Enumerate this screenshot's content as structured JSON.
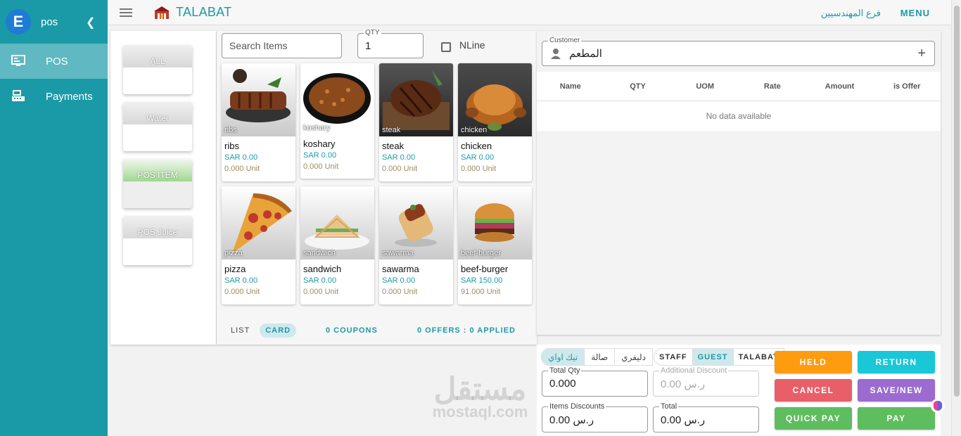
{
  "sidebar": {
    "logo_letter": "E",
    "title": "pos",
    "items": [
      {
        "label": "POS",
        "icon": "monitor-icon",
        "active": true
      },
      {
        "label": "Payments",
        "icon": "register-icon",
        "active": false
      }
    ]
  },
  "topbar": {
    "brand": "TALABAT",
    "branch": "فرع المهندسيين",
    "menu_label": "MENU"
  },
  "categories": [
    {
      "label": "ALL"
    },
    {
      "label": "Water"
    },
    {
      "label": "POS ITEM"
    },
    {
      "label": "POS Juice"
    }
  ],
  "search": {
    "placeholder": "Search Items"
  },
  "qty": {
    "label": "QTY",
    "value": "1"
  },
  "nline": {
    "label": "NLine"
  },
  "items": [
    {
      "name": "ribs",
      "price": "SAR 0.00",
      "unit": "0.000 Unit"
    },
    {
      "name": "koshary",
      "price": "SAR 0.00",
      "unit": "0.000 Unit"
    },
    {
      "name": "steak",
      "price": "SAR 0.00",
      "unit": "0.000 Unit"
    },
    {
      "name": "chicken",
      "price": "SAR 0.00",
      "unit": "0.000 Unit"
    },
    {
      "name": "pizza",
      "price": "SAR 0.00",
      "unit": "0.000 Unit"
    },
    {
      "name": "sandwich",
      "price": "SAR 0.00",
      "unit": "0.000 Unit"
    },
    {
      "name": "sawarma",
      "price": "SAR 0.00",
      "unit": "0.000 Unit"
    },
    {
      "name": "beef-burger",
      "price": "SAR 150.00",
      "unit": "91.000 Unit"
    }
  ],
  "item_view": {
    "list": "LIST",
    "card": "CARD",
    "coupons": "0 COUPONS",
    "offers": "0 OFFERS : 0 APPLIED"
  },
  "customer": {
    "label": "Customer",
    "value": "المطعم"
  },
  "cart_table": {
    "headers": [
      "Name",
      "QTY",
      "UOM",
      "Rate",
      "Amount",
      "is Offer"
    ],
    "empty": "No data available"
  },
  "order_types": [
    "تيك اواي",
    "صالة",
    "دليفري"
  ],
  "order_types_active": 0,
  "guest_types": [
    "STAFF",
    "GUEST",
    "TALABAT"
  ],
  "guest_types_active": 1,
  "totals": {
    "total_qty": {
      "label": "Total Qty",
      "value": "0.000"
    },
    "additional_discount": {
      "label": "Additional Discount",
      "value": "ر.س 0.00"
    },
    "items_discounts": {
      "label": "Items Discounts",
      "value": "ر.س 0.00"
    },
    "total": {
      "label": "Total",
      "value": "ر.س 0.00"
    }
  },
  "actions": {
    "held": "HELD",
    "return": "RETURN",
    "cancel": "CANCEL",
    "save_new": "SAVE/NEW",
    "quick_pay": "QUICK PAY",
    "pay": "PAY"
  },
  "watermark": {
    "ar": "مستقل",
    "en": "mostaql.com"
  },
  "colors": {
    "accent": "#1a9aa6",
    "held": "#fe9b0f",
    "return": "#1ac7d6",
    "cancel": "#e85f6a",
    "save_new": "#9b6bd0",
    "pay": "#5ebd5e"
  }
}
